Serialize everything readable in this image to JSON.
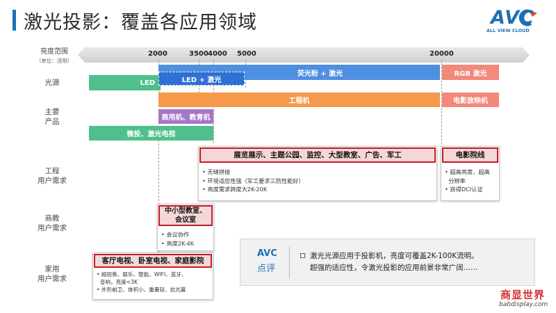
{
  "title": "激光投影：覆盖各应用领域",
  "logo": {
    "mark": "AVC",
    "tagline": "ALL VIEW CLOUD"
  },
  "axis": {
    "label": "亮度范围",
    "unit_note": "（单位：流明）",
    "ticks": [
      "2000",
      "3500",
      "4000",
      "5000",
      "20000"
    ]
  },
  "rows": {
    "light_source": "光源",
    "main_products_1": "主要",
    "main_products_2": "产品",
    "engineering_1": "工程",
    "engineering_2": "用户需求",
    "education_1": "商教",
    "education_2": "用户需求",
    "home_1": "家用",
    "home_2": "用户需求"
  },
  "bars": {
    "led": "LED",
    "led_laser": "LED + 激光",
    "phosphor_laser": "荧光粉 + 激光",
    "rgb_laser": "RGB 激光",
    "engineering_projector": "工程机",
    "cinema_projector": "电影放映机",
    "business_edu_projector": "商用机、教育机",
    "micro_laser_tv": "微投、激光电视"
  },
  "engineering_box": {
    "header": "展览展示、主题公园、监控、大型教室、广告、军工",
    "bullets": [
      "无缝拼接",
      "环境适应性强（军工要求三防性能好）",
      "亮度需求跨度大2K-20K"
    ]
  },
  "cinema_box": {
    "header": "电影院线",
    "bullets": [
      "超高亮度，超高",
      "分辨率",
      "获得DCI认证"
    ]
  },
  "education_box": {
    "header_1": "中小型教室、",
    "header_2": "会议室",
    "bullets": [
      "会议协作",
      "亮度2K-4K"
    ]
  },
  "home_box": {
    "header": "客厅电视、卧室电视、家庭影院",
    "bullets": [
      "超短焦、娱乐、智能、WIFI、蓝牙、",
      "音响，亮度<3K",
      "外形前卫、体积小、重量轻、抗光幕"
    ]
  },
  "review": {
    "brand": "AVC",
    "label": "点评",
    "line1": "激光光源应用于投影机，亮度可覆盖2K-100K流明。",
    "line2": "超强的适应性，令激光投影的应用前景非常广阔……"
  },
  "watermark": {
    "cn": "商显世界",
    "en": "babdisplay.com"
  },
  "colors": {
    "accent_blue": "#1f6fb5",
    "green": "#4fbf8b",
    "blue": "#4e8fe0",
    "salmon": "#f2897a",
    "orange": "#f59a4a",
    "purple": "#a676c8",
    "red_border": "#c41a22"
  }
}
